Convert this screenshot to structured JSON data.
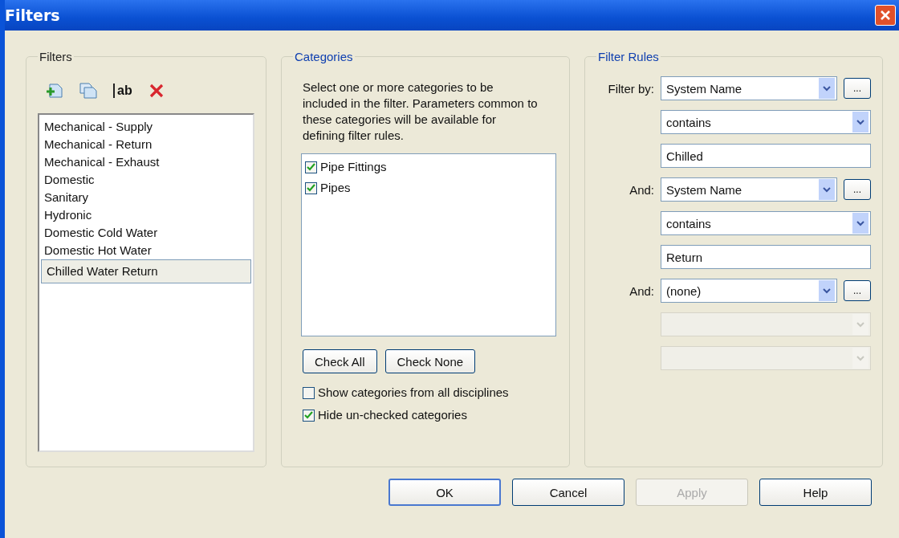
{
  "window": {
    "title": "Filters"
  },
  "filters": {
    "legend": "Filters",
    "toolbar": [
      {
        "kind": "new"
      },
      {
        "kind": "duplicate"
      },
      {
        "kind": "rename",
        "text": "ab"
      },
      {
        "kind": "delete"
      }
    ],
    "items": [
      {
        "label": "Mechanical - Supply",
        "selected": false
      },
      {
        "label": "Mechanical - Return",
        "selected": false
      },
      {
        "label": "Mechanical - Exhaust",
        "selected": false
      },
      {
        "label": "Domestic",
        "selected": false
      },
      {
        "label": "Sanitary",
        "selected": false
      },
      {
        "label": "Hydronic",
        "selected": false
      },
      {
        "label": "Domestic Cold Water",
        "selected": false
      },
      {
        "label": "Domestic Hot Water",
        "selected": false
      },
      {
        "label": "Chilled Water Return",
        "selected": true
      }
    ]
  },
  "categories": {
    "legend": "Categories",
    "description": "Select one or more categories to be included in the filter.  Parameters common to these categories will be available for defining filter rules.",
    "items": [
      {
        "label": "Pipe Fittings",
        "checked": true
      },
      {
        "label": "Pipes",
        "checked": true
      }
    ],
    "buttons": [
      "Check All",
      "Check None"
    ],
    "options": [
      {
        "label": "Show categories from all disciplines",
        "checked": false
      },
      {
        "label": "Hide un-checked categories",
        "checked": true
      }
    ]
  },
  "filter_rules": {
    "legend": "Filter Rules",
    "rows": [
      {
        "kind": "select",
        "label": "Filter by:",
        "value": "System Name",
        "ellipsis": "...",
        "disabled": false
      },
      {
        "kind": "select",
        "value": "contains",
        "disabled": false
      },
      {
        "kind": "text",
        "value": "Chilled"
      },
      {
        "kind": "select",
        "label": "And:",
        "value": "System Name",
        "ellipsis": "...",
        "disabled": false
      },
      {
        "kind": "select",
        "value": "contains",
        "disabled": false
      },
      {
        "kind": "text",
        "value": "Return"
      },
      {
        "kind": "select",
        "label": "And:",
        "value": "(none)",
        "ellipsis": "...",
        "disabled": false
      },
      {
        "kind": "select",
        "disabled": true
      },
      {
        "kind": "select",
        "disabled": true
      }
    ]
  },
  "buttons": [
    {
      "label": "OK",
      "disabled": false,
      "default": true
    },
    {
      "label": "Cancel",
      "disabled": false,
      "default": false
    },
    {
      "label": "Apply",
      "disabled": true,
      "default": false
    },
    {
      "label": "Help",
      "disabled": false,
      "default": false
    }
  ]
}
